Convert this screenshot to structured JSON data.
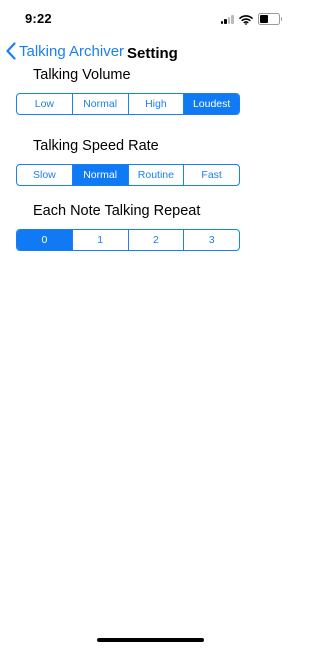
{
  "status_bar": {
    "time": "9:22",
    "icons": [
      "cellular-signal-icon",
      "wifi-icon",
      "battery-icon"
    ],
    "battery_level": 0.45
  },
  "nav": {
    "back_label": "Talking Archiver",
    "title": "Setting",
    "accent_color": "#1a7ff4"
  },
  "settings": [
    {
      "title": "Talking Volume",
      "options": [
        "Low",
        "Normal",
        "High",
        "Loudest"
      ],
      "selected_index": 3
    },
    {
      "title": "Talking Speed Rate",
      "options": [
        "Slow",
        "Normal",
        "Routine",
        "Fast"
      ],
      "selected_index": 1
    },
    {
      "title": "Each Note Talking Repeat",
      "options": [
        "0",
        "1",
        "2",
        "3"
      ],
      "selected_index": 0
    }
  ]
}
